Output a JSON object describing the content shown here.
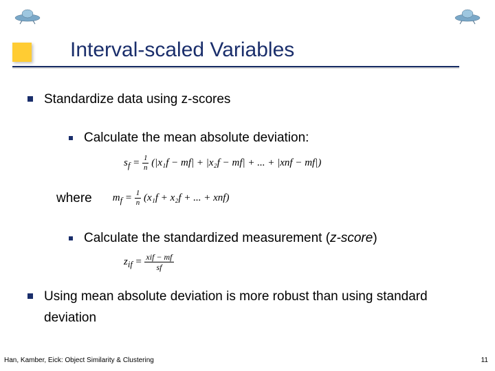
{
  "title": "Interval-scaled Variables",
  "bullets": {
    "main1": "Standardize data using z-scores",
    "sub1": "Calculate the mean absolute deviation:",
    "where": "where",
    "sub2_pre": "Calculate the standardized measurement (",
    "sub2_em": "z-score",
    "sub2_post": ")",
    "main2": "Using mean absolute deviation is more robust than using standard deviation"
  },
  "formulas": {
    "mad_lhs": "s",
    "mad_sub": "f",
    "mad_eq": " = ",
    "mad_frac_n": "1",
    "mad_frac_d": "n",
    "mad_terms": "(|x₁f − mf| + |x₂f − mf| + ... + |xnf − mf|)",
    "mean_lhs": "m",
    "mean_sub": "f",
    "mean_eq": " = ",
    "mean_frac_n": "1",
    "mean_frac_d": "n",
    "mean_terms": "(x₁f + x₂f + ... + xnf)",
    "z_lhs": "z",
    "z_sub": "if",
    "z_eq": " = ",
    "z_num": "xif − mf",
    "z_den": "sf"
  },
  "footer": {
    "left": "Han, Kamber, Eick: Object Similarity & Clustering",
    "right": "11"
  }
}
